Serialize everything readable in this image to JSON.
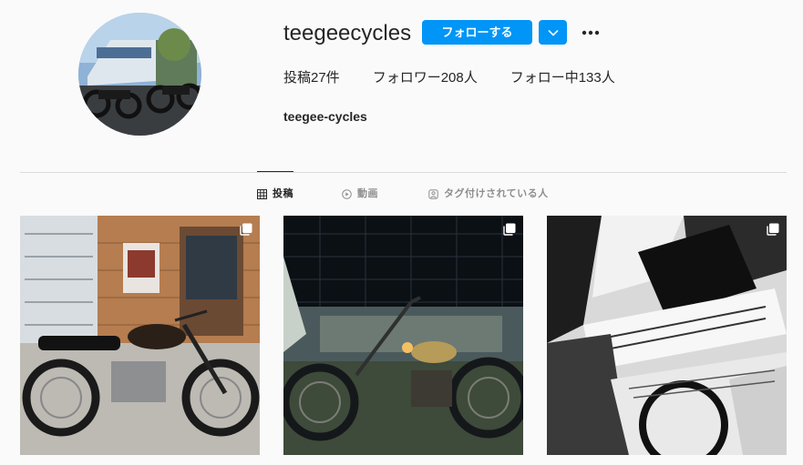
{
  "profile": {
    "username": "teegeecycles",
    "follow_label": "フォローする",
    "posts_label": "投稿27件",
    "followers_label": "フォロワー208人",
    "following_label": "フォロー中133人",
    "full_name": "teegee-cycles"
  },
  "tabs": [
    {
      "label": "投稿",
      "active": true,
      "icon": "grid-icon"
    },
    {
      "label": "動画",
      "active": false,
      "icon": "play-circle-icon"
    },
    {
      "label": "タグ付けされている人",
      "active": false,
      "icon": "tag-icon"
    }
  ],
  "posts": [
    {
      "description": "post-1",
      "icon": "multi-image-icon"
    },
    {
      "description": "post-2",
      "icon": "multi-image-icon"
    },
    {
      "description": "post-3",
      "icon": "multi-image-icon"
    }
  ],
  "colors": {
    "accent": "#0095f6",
    "text": "#262626",
    "muted": "#8e8e8e",
    "background": "#fafafa",
    "divider": "#dbdbdb"
  }
}
